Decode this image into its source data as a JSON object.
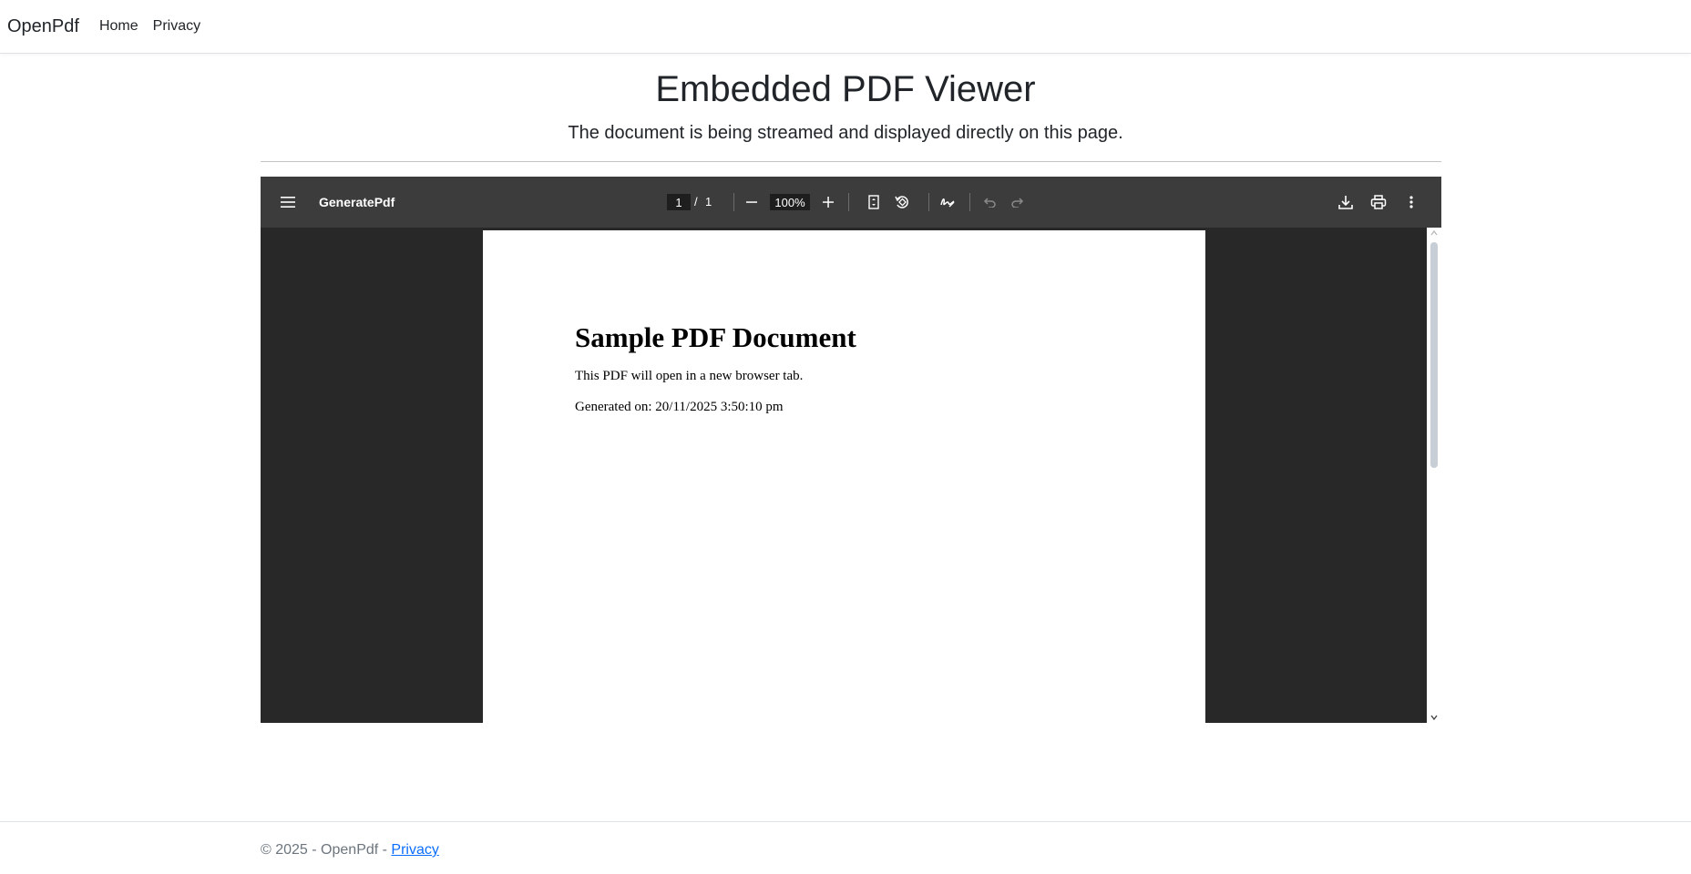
{
  "navbar": {
    "brand": "OpenPdf",
    "links": [
      "Home",
      "Privacy"
    ]
  },
  "header": {
    "title": "Embedded PDF Viewer",
    "lead": "The document is being streamed and displayed directly on this page."
  },
  "viewer": {
    "doc_title": "GeneratePdf",
    "page_current": "1",
    "page_separator": "/",
    "page_total": "1",
    "zoom": "100%",
    "icons": {
      "menu": "menu-icon",
      "zoom_out": "minus-icon",
      "zoom_in": "plus-icon",
      "fit_page": "fit-page-icon",
      "rotate": "rotate-icon",
      "draw": "draw-icon",
      "undo": "undo-icon",
      "redo": "redo-icon",
      "download": "download-icon",
      "print": "print-icon",
      "more": "more-vertical-icon"
    },
    "pdf": {
      "heading": "Sample PDF Document",
      "line1": "This PDF will open in a new browser tab.",
      "line2": "Generated on: 20/11/2025 3:50:10 pm"
    }
  },
  "footer": {
    "text": "© 2025 - OpenPdf - ",
    "link": "Privacy"
  },
  "colors": {
    "toolbar": "#3c3c3c",
    "viewer_bg": "#282828",
    "link": "#0d6efd"
  }
}
